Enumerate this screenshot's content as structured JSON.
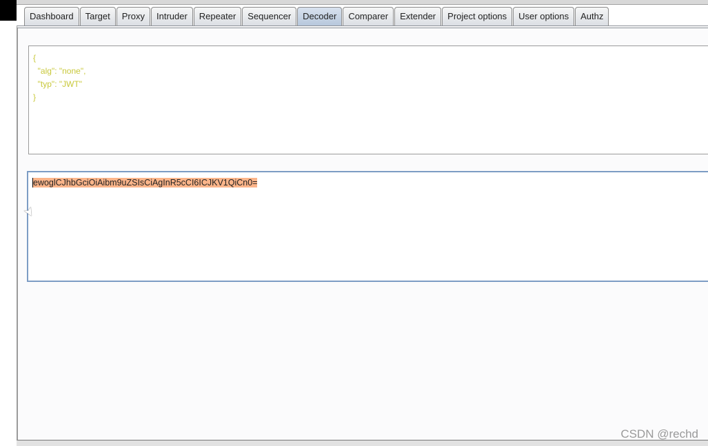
{
  "tabs": [
    "Dashboard",
    "Target",
    "Proxy",
    "Intruder",
    "Repeater",
    "Sequencer",
    "Decoder",
    "Comparer",
    "Extender",
    "Project options",
    "User options",
    "Authz"
  ],
  "active_tab": "Decoder",
  "decoded_output": "{\n  \"alg\": \"none\",\n  \"typ\": \"JWT\"\n}",
  "encoded_input": "ewoglCJhbGciOiAibm9uZSIsCiAgInR5cCI6ICJKV1QiCn0=",
  "watermark": "CSDN @rechd",
  "colors": {
    "output_text": "#c8c83a",
    "selection": "#fcb58a"
  }
}
